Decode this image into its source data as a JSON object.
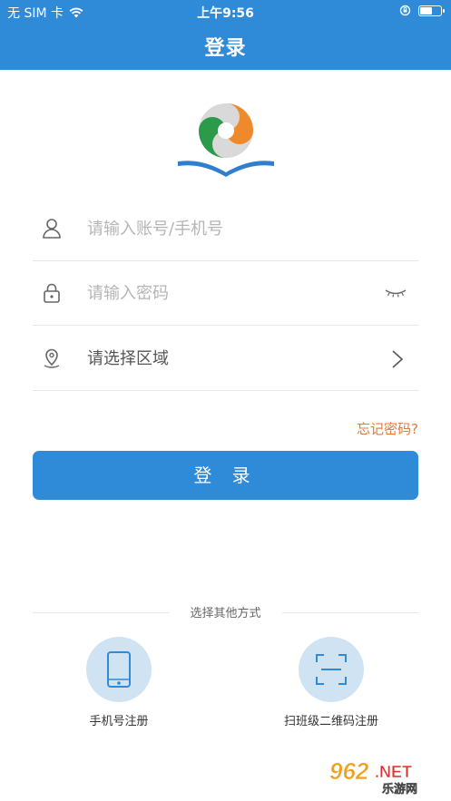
{
  "status_bar": {
    "carrier": "无 SIM 卡",
    "time": "上午9:56"
  },
  "header": {
    "title": "登录"
  },
  "form": {
    "account_placeholder": "请输入账号/手机号",
    "password_placeholder": "请输入密码",
    "region_label": "请选择区域",
    "forgot_password": "忘记密码?",
    "login_button": "登 录"
  },
  "other_methods": {
    "divider_label": "选择其他方式",
    "phone_register": "手机号注册",
    "qr_register": "扫班级二维码注册"
  },
  "watermark": {
    "brand": "962",
    "suffix": ".NET",
    "sub": "乐游网"
  },
  "colors": {
    "primary": "#2f8ad8",
    "accent_orange": "#e07a3b",
    "icon_circle": "#cfe3f3"
  }
}
